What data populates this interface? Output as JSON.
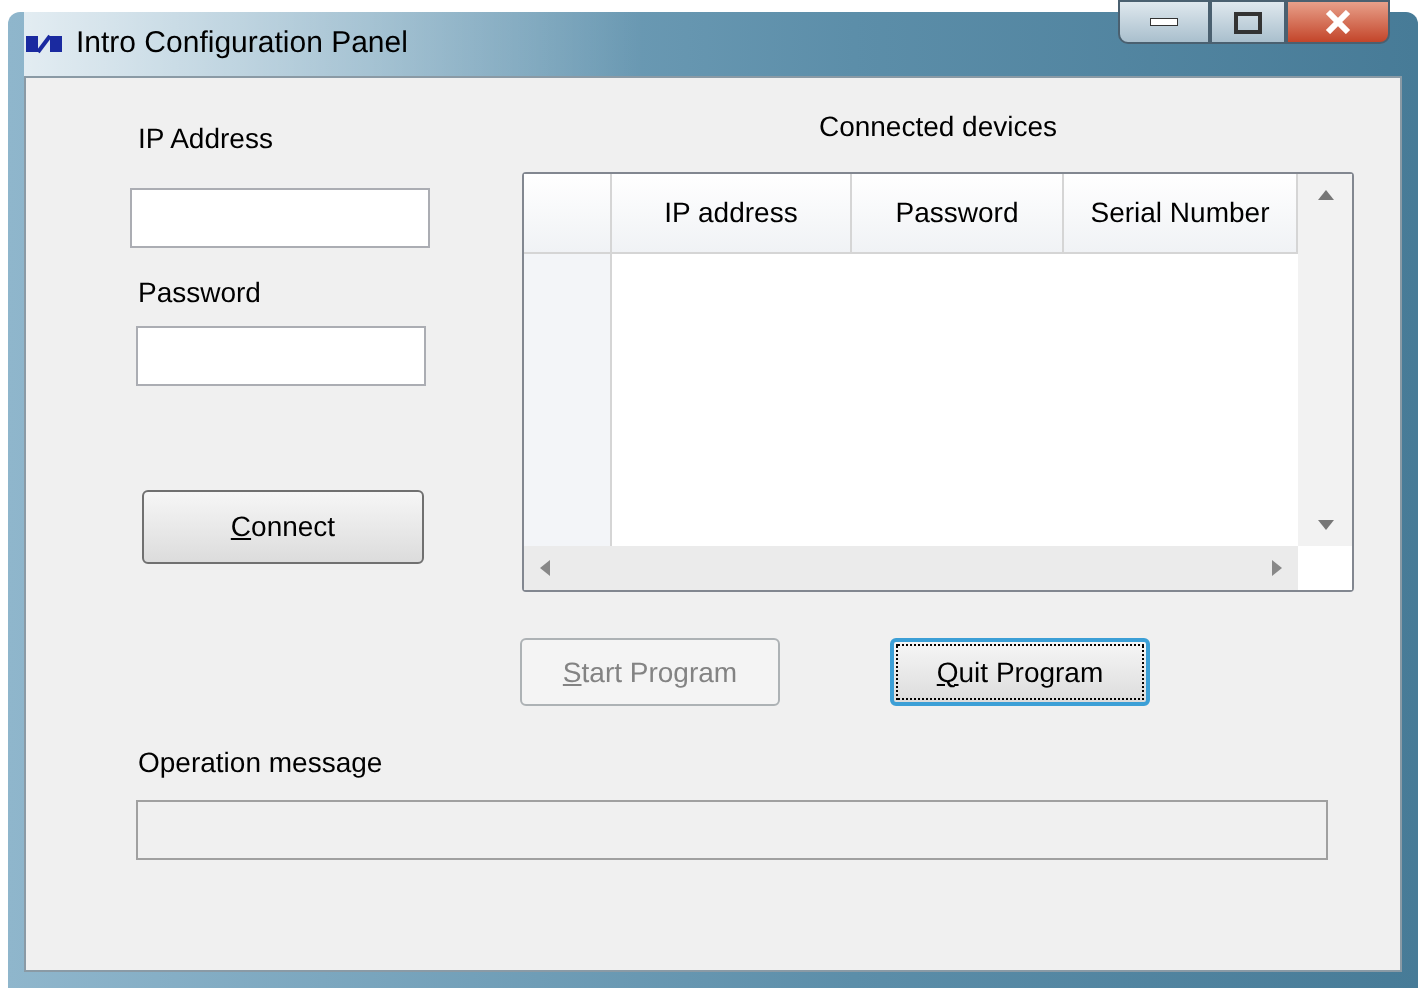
{
  "window": {
    "title": "Intro Configuration Panel"
  },
  "ip_address": {
    "label": "IP Address"
  },
  "password": {
    "label": "Password"
  },
  "connect_button": {
    "label": "Connect",
    "mnemonic": true,
    "disabled": false
  },
  "devices": {
    "title": "Connected devices",
    "columns": [
      "IP address",
      "Password",
      "Serial Number"
    ]
  },
  "buttons": [
    {
      "label": "Start Program",
      "mnemonic": true,
      "disabled": true,
      "focused": false
    },
    {
      "label": "Quit Program",
      "mnemonic": true,
      "disabled": false,
      "focused": true
    }
  ],
  "operation_message": {
    "label": "Operation message"
  }
}
